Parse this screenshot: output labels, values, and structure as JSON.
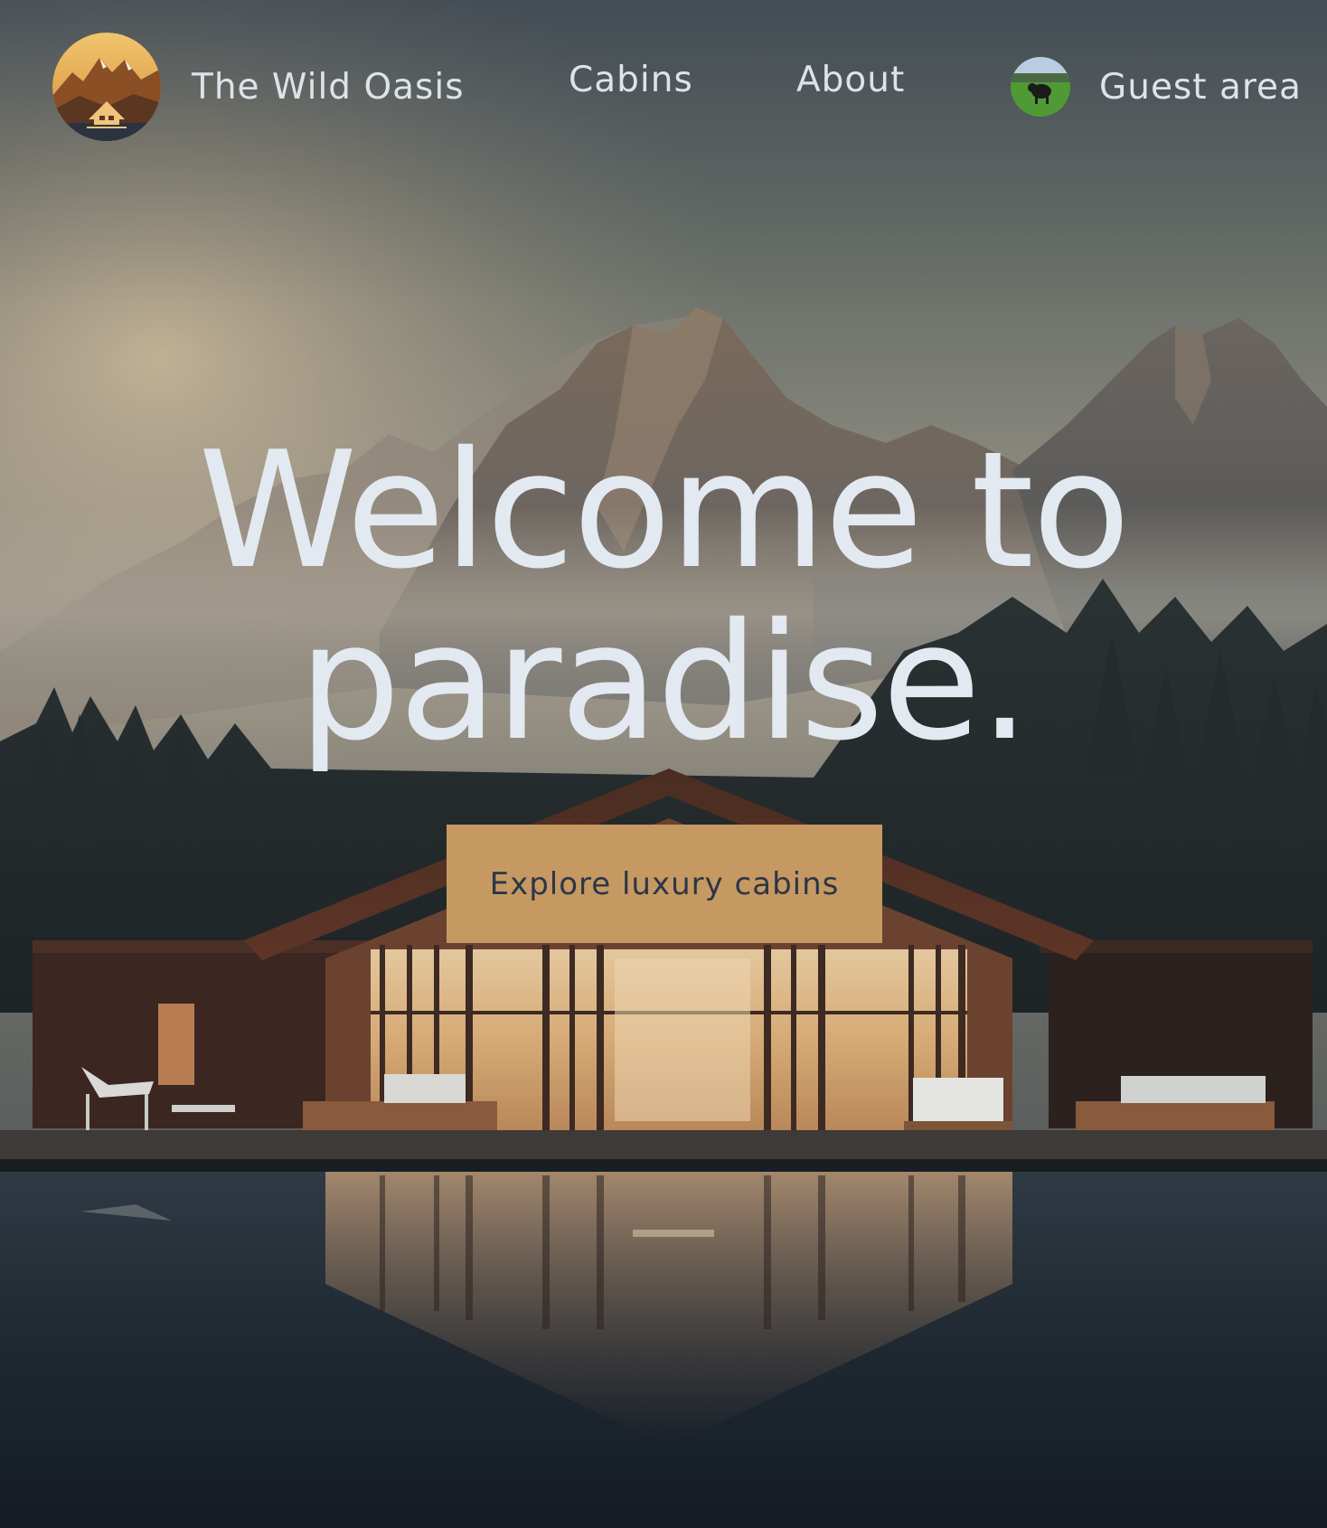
{
  "header": {
    "brand_name": "The Wild Oasis",
    "logo_icon": "mountain-cabin-logo-icon",
    "nav": {
      "cabins_label": "Cabins",
      "about_label": "About",
      "guest_label": "Guest area",
      "guest_avatar_icon": "user-avatar-icon"
    }
  },
  "hero": {
    "title": "Welcome to paradise.",
    "cta_label": "Explore luxury cabins",
    "background_image": "lake-cabin-mountains-photo"
  },
  "colors": {
    "accent": "#c69963",
    "text_light": "#e3e9f1",
    "button_text": "#2c3745",
    "page_background": "#141b24"
  }
}
